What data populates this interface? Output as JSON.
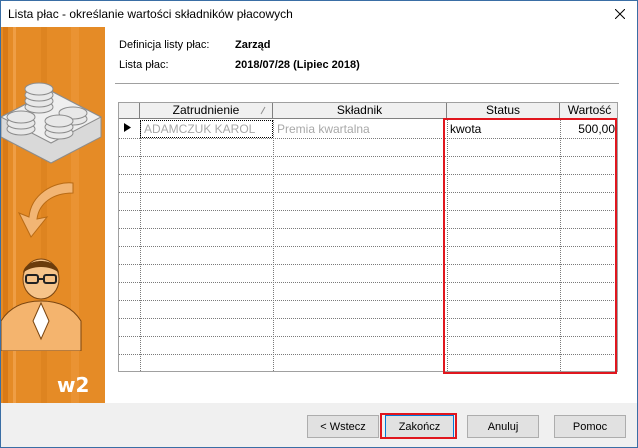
{
  "window": {
    "title": "Lista płac - określanie wartości składników płacowych",
    "close_icon": "close-icon"
  },
  "side_panel": {
    "logo_text": "w2"
  },
  "info": {
    "definition_label": "Definicja listy płac:",
    "definition_value": "Zarząd",
    "list_label": "Lista płac:",
    "list_value": "2018/07/28 (Lipiec 2018)"
  },
  "grid": {
    "columns": [
      "Zatrudnienie",
      "Składnik",
      "Status",
      "Wartość"
    ],
    "rows": [
      {
        "employee": "ADAMCZUK KAROL",
        "component": "Premia kwartalna",
        "status": "kwota",
        "value": "500,00"
      }
    ]
  },
  "buttons": {
    "back": "< Wstecz",
    "finish": "Zakończ",
    "cancel": "Anuluj",
    "help": "Pomoc"
  },
  "colors": {
    "panel_orange": "#e58b26",
    "annotation_red": "#e0161e"
  }
}
